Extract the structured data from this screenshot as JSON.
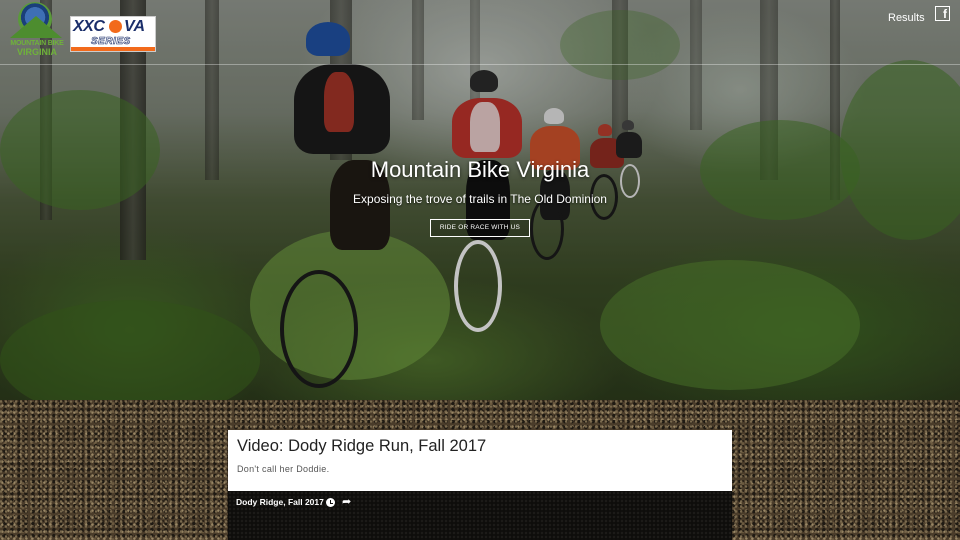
{
  "header": {
    "logo_mbv_line1": "MOUNTAIN BIKE",
    "logo_mbv_line2": "VIRGINIA",
    "logo_xc_text_left": "XXC",
    "logo_xc_text_right": "VA",
    "logo_xc_series": "SERIES",
    "nav_results": "Results",
    "facebook_icon": "facebook-icon"
  },
  "hero": {
    "title": "Mountain Bike Virginia",
    "subtitle": "Exposing the trove of trails in The Old Dominion",
    "cta_label": "RIDE OR RACE WITH US"
  },
  "post": {
    "title": "Video: Dody Ridge Run, Fall 2017",
    "excerpt": "Don't call her Doddie.",
    "video_title": "Dody Ridge, Fall 2017",
    "watch_later_icon": "clock-icon",
    "share_icon": "share-icon"
  },
  "colors": {
    "accent_orange": "#f26a1b",
    "logo_green": "#6fb33a",
    "logo_navy": "#1a2e6a"
  }
}
